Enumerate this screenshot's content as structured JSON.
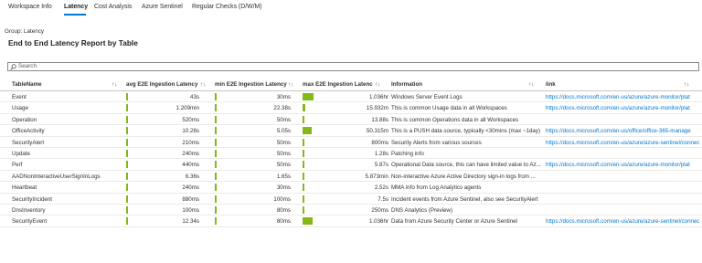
{
  "tabs": [
    {
      "label": "Workspace Info"
    },
    {
      "label": "Latency"
    },
    {
      "label": "Cost Analysis"
    },
    {
      "label": "Azure Sentinel"
    },
    {
      "label": "Regular Checks (D/W/M)"
    }
  ],
  "group_label": "Group: Latency",
  "report_title": "End to End Latency Report by Table",
  "search": {
    "placeholder": "Search",
    "value": ""
  },
  "colors": {
    "accent": "#0078d4",
    "bar": "#84b817"
  },
  "table": {
    "columns": [
      {
        "label": "TableName"
      },
      {
        "label": "avg E2E Ingestion Latency"
      },
      {
        "label": "min E2E Ingestion Latency"
      },
      {
        "label": "max E2E Ingestion Latenc"
      },
      {
        "label": "Information"
      },
      {
        "label": "link"
      }
    ],
    "sort_icon": "↑↓",
    "rows": [
      {
        "name": "Event",
        "avg": "43s",
        "avg_level": 0.02,
        "min": "30ms",
        "min_level": 0.02,
        "max": "1.036hr",
        "max_level": 1.0,
        "info": "Windows Server Event Logs",
        "link": "https://docs.microsoft.com/en-us/azure/azure-monitor/plat"
      },
      {
        "name": "Usage",
        "avg": "1.209min",
        "avg_level": 0.02,
        "min": "22.38s",
        "min_level": 0.02,
        "max": "15.932m",
        "max_level": 0.25,
        "info": "This is common Usage data in all Workspaces",
        "link": "https://docs.microsoft.com/en-us/azure/azure-monitor/plat"
      },
      {
        "name": "Operation",
        "avg": "520ms",
        "avg_level": 0.02,
        "min": "50ms",
        "min_level": 0.02,
        "max": "13.88s",
        "max_level": 0.02,
        "info": "This is common Operations data in all Workspaces",
        "link": ""
      },
      {
        "name": "OfficeActivity",
        "avg": "10.28s",
        "avg_level": 0.02,
        "min": "5.05s",
        "min_level": 0.02,
        "max": "50.315m",
        "max_level": 0.8,
        "info": "This is a PUSH data source, typically <30mins (max ~1day)",
        "link": "https://docs.microsoft.com/en-us/office/office-365-manage"
      },
      {
        "name": "SecurityAlert",
        "avg": "210ms",
        "avg_level": 0.02,
        "min": "50ms",
        "min_level": 0.02,
        "max": "800ms",
        "max_level": 0.02,
        "info": "Security Alerts from various sources",
        "link": "https://docs.microsoft.com/en-us/azure/azure-sentinel/connect-d"
      },
      {
        "name": "Update",
        "avg": "240ms",
        "avg_level": 0.02,
        "min": "50ms",
        "min_level": 0.02,
        "max": "1.28s",
        "max_level": 0.02,
        "info": "Patching info",
        "link": ""
      },
      {
        "name": "Perf",
        "avg": "440ms",
        "avg_level": 0.02,
        "min": "50ms",
        "min_level": 0.02,
        "max": "5.87s",
        "max_level": 0.02,
        "info": "Operational Data source, this can have limited value to Az...",
        "link": "https://docs.microsoft.com/en-us/azure/azure-monitor/plat"
      },
      {
        "name": "AADNonInteractiveUserSignInLogs",
        "avg": "6.36s",
        "avg_level": 0.02,
        "min": "1.65s",
        "min_level": 0.02,
        "max": "5.873min",
        "max_level": 0.02,
        "info": "Non-interactive Azure Active Directory sign-in logs from ...",
        "link": ""
      },
      {
        "name": "Heartbeat",
        "avg": "240ms",
        "avg_level": 0.02,
        "min": "30ms",
        "min_level": 0.02,
        "max": "2.52s",
        "max_level": 0.02,
        "info": "MMA info from Log Analytics agents",
        "link": ""
      },
      {
        "name": "SecurityIncident",
        "avg": "880ms",
        "avg_level": 0.02,
        "min": "100ms",
        "min_level": 0.02,
        "max": "7.5s",
        "max_level": 0.02,
        "info": "Incident events from Azure Sentinel, also see SecurityAlert",
        "link": ""
      },
      {
        "name": "DnsInventory",
        "avg": "100ms",
        "avg_level": 0.02,
        "min": "80ms",
        "min_level": 0.02,
        "max": "250ms",
        "max_level": 0.02,
        "info": "DNS Analytics (Preview)",
        "link": ""
      },
      {
        "name": "SecurityEvent",
        "avg": "12.34s",
        "avg_level": 0.02,
        "min": "80ms",
        "min_level": 0.02,
        "max": "1.036hr",
        "max_level": 0.9,
        "info": "Data from Azure Security Center or Azure Sentinel",
        "link": "https://docs.microsoft.com/en-us/azure/azure-sentinel/connect-d"
      }
    ]
  }
}
